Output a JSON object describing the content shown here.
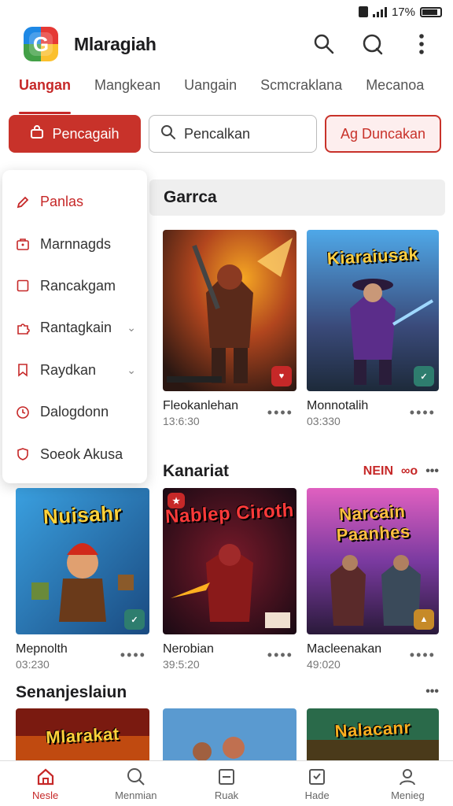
{
  "status": {
    "battery_text": "17%"
  },
  "header": {
    "title": "Mlaragiah"
  },
  "tabs": [
    {
      "label": "Uangan",
      "active": true
    },
    {
      "label": "Mangkean",
      "active": false
    },
    {
      "label": "Uangain",
      "active": false
    },
    {
      "label": "Scmcraklana",
      "active": false
    },
    {
      "label": "Mecanoa",
      "active": false
    }
  ],
  "actions": {
    "primary_label": "Pencagaih",
    "search_value": "Pencalkan",
    "outline_label": "Ag Duncakan"
  },
  "menu": [
    {
      "label": "Panlas",
      "icon": "pencil-icon",
      "active": true
    },
    {
      "label": "Marnnagds",
      "icon": "briefcase-icon",
      "active": false
    },
    {
      "label": "Rancakgam",
      "icon": "square-icon",
      "active": false
    },
    {
      "label": "Rantagkain",
      "icon": "puzzle-icon",
      "active": false,
      "chevron": true
    },
    {
      "label": "Raydkan",
      "icon": "bookmark-icon",
      "active": false,
      "chevron": true
    },
    {
      "label": "Dalogdonn",
      "icon": "clock-icon",
      "active": false
    },
    {
      "label": "Soeok Akusa",
      "icon": "shield-icon",
      "active": false
    }
  ],
  "sections": {
    "first": {
      "title": "Garrca"
    },
    "second": {
      "title": "Kanariat",
      "more_label": "NEIN",
      "more_extra": "∞o"
    },
    "third": {
      "title": "Senanjeslaiun"
    }
  },
  "cards_row1": [
    {
      "name": "Fleokanlehan",
      "meta": "13:6:30",
      "title_art": "",
      "badge_color": "#c62828"
    },
    {
      "name": "Monnotalih",
      "meta": "03:330",
      "title_art": "Kiaraiusak",
      "badge_color": "#2e7d6e"
    }
  ],
  "cards_row2": [
    {
      "name": "Mepnolth",
      "meta": "03:230",
      "title_art": "Nuisahr",
      "badge_color": "#2e7d6e"
    },
    {
      "name": "Nerobian",
      "meta": "39:5:20",
      "title_art": "Nablep Ciroth",
      "badge_color": "#c62828"
    },
    {
      "name": "Macleenakan",
      "meta": "49:020",
      "title_art": "Narcain Paanhes",
      "badge_color": "#c68a28"
    }
  ],
  "cards_row3": [
    {
      "title_art": "Mlarakat"
    },
    {
      "title_art": ""
    },
    {
      "title_art": "Nalacanr"
    }
  ],
  "bottom_nav": [
    {
      "label": "Nesle",
      "icon": "home-icon",
      "active": true
    },
    {
      "label": "Menmian",
      "icon": "search-icon",
      "active": false
    },
    {
      "label": "Ruak",
      "icon": "grid-card-icon",
      "active": false
    },
    {
      "label": "Hade",
      "icon": "check-card-icon",
      "active": false
    },
    {
      "label": "Menieg",
      "icon": "profile-icon",
      "active": false
    }
  ],
  "colors": {
    "accent": "#c8322a",
    "active_text": "#c62828"
  }
}
